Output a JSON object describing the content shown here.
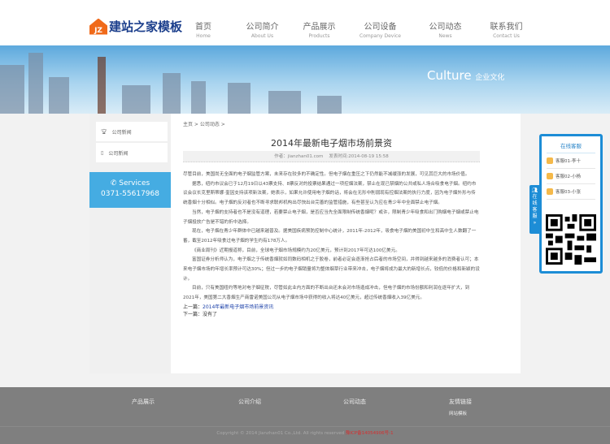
{
  "logo": {
    "badge": "JZ",
    "text": "建站之家模板"
  },
  "nav": [
    {
      "zh": "首页",
      "en": "Home"
    },
    {
      "zh": "公司简介",
      "en": "About Us"
    },
    {
      "zh": "产品展示",
      "en": "Products"
    },
    {
      "zh": "公司设备",
      "en": "Company Device"
    },
    {
      "zh": "公司动态",
      "en": "News"
    },
    {
      "zh": "联系我们",
      "en": "Contact Us"
    }
  ],
  "banner": {
    "title": "Culture",
    "subtitle": "企业文化"
  },
  "sidebar": {
    "items": [
      "公司新闻",
      "公司新闻"
    ],
    "services_label": "Services",
    "phone": "0371-55617968"
  },
  "breadcrumb": "主页 > 公司动态 >",
  "article": {
    "title": "2014年最新电子烟市场前景资",
    "author": "作者：jianzhan01.com",
    "date": "发表时间:2014-08-19 15:58",
    "paragraphs": [
      "尽管目前，美国尚无全面的电子烟监管方案，未来存在较多的不确定性。但电子烟在重压之下仍然能不减缓涨的发展，可见其巨大的市场价值。",
      "据悉，纽约市议会已于12月19日以43票支持、8票反对的投票结果通过一项控烟法案，禁止在现已禁烟的公共或私人场合吸食电子烟。纽约市议会议长克里斯蒂娜·奎因支持该项新法案，她表示，如果允许使用电子烟的话，将会在无形中削弱现有控烟法案的执行力度，因为电子烟外形与传统香烟十分相似。电子烟的反对者也不断寻求联邦机构出尽快出台完善的监管措施，有些甚至认为应在青少年中全面禁止电子烟。",
      "当然，电子烟的支持者也不是没有道理，若要禁止电子烟，是否应当先全面限制传统香烟呢？或许，限制青少年吸食和出门购烟电子烟或禁止电子烟投放广告是不错的折中选择。",
      "现在，电子烟在青少年群体中已越来越普及。据美国疾病预防控制中心统计，2011年-2012年，吸食电子烟的美国初中生和高中生人数翻了一番，截至2012年吸食过电子烟的学生约有178万人。",
      "《商业周刊》近期报道称，目前，全球电子烟市场规模约为20亿美元，预计到2017年可达100亿美元。",
      "富国证券分析师认为，电子烟之于传统香烟就如同数码相机之于胶卷，前者必定会逐渐抢占后者的市场空间，并得到越来越多的消费者认可；本来电子烟市场的年增长率预计可达30%；但过一步的电子烟销量将为整体烟草行业带来冲击，电子烟将成为最大的新增长点，较低的价格和新颖的设计。",
      "目前，只有美国纽约等地对电子烟征税，尽管如此业内方面的不断出台还未会对市场造成冲击，但电子烟的市场份额和利润在逐年扩大，到2021年，美国第二大香烟生产商雷诺美国公司从电子烟市场中获得的收入将达40亿美元，超过传统香烟收入39亿美元。"
    ],
    "prev_label": "上一篇：",
    "prev_link": "2014年最新电子烟市场前景资讯",
    "next_label": "下一篇：",
    "next_text": "没有了"
  },
  "kefu": {
    "title": "在线客服",
    "items": [
      "客服01-李十",
      "客服02-小杨",
      "客服03-小张"
    ],
    "tab": "在线客服",
    "tab_arrow": "»"
  },
  "footer": {
    "cols": [
      "产品展示",
      "公司介绍",
      "公司动态",
      "友情链接"
    ],
    "link": "网站模板",
    "copyright": "Copyright © 2014 Jianzhan01 Co.,Ltd. All rights reserved",
    "icp": "豫ICP备14054906号-1"
  }
}
